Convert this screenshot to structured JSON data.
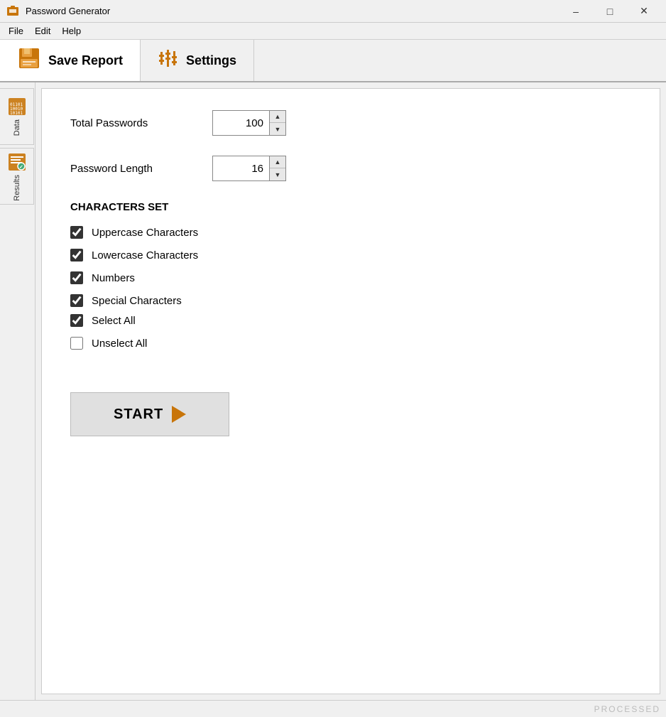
{
  "window": {
    "title": "Password Generator",
    "minimize_label": "–",
    "maximize_label": "□",
    "close_label": "✕"
  },
  "menu": {
    "items": [
      {
        "label": "File"
      },
      {
        "label": "Edit"
      },
      {
        "label": "Help"
      }
    ]
  },
  "toolbar": {
    "save_report_label": "Save Report",
    "settings_label": "Settings"
  },
  "sidebar": {
    "tabs": [
      {
        "label": "Data",
        "id": "data"
      },
      {
        "label": "Results",
        "id": "results"
      }
    ]
  },
  "form": {
    "total_passwords_label": "Total Passwords",
    "total_passwords_value": "100",
    "password_length_label": "Password Length",
    "password_length_value": "16",
    "characters_set_heading": "CHARACTERS SET",
    "checkboxes": [
      {
        "id": "uppercase",
        "label": "Uppercase Characters",
        "checked": true
      },
      {
        "id": "lowercase",
        "label": "Lowercase Characters",
        "checked": true
      },
      {
        "id": "numbers",
        "label": "Numbers",
        "checked": true
      },
      {
        "id": "special",
        "label": "Special Characters",
        "checked": true
      }
    ],
    "select_all_label": "Select All",
    "select_all_checked": true,
    "unselect_all_label": "Unselect All",
    "unselect_all_checked": false,
    "start_label": "START"
  },
  "status": {
    "text": "PROCESSED"
  },
  "colors": {
    "orange": "#c8750a",
    "toolbar_border": "#aaa"
  }
}
